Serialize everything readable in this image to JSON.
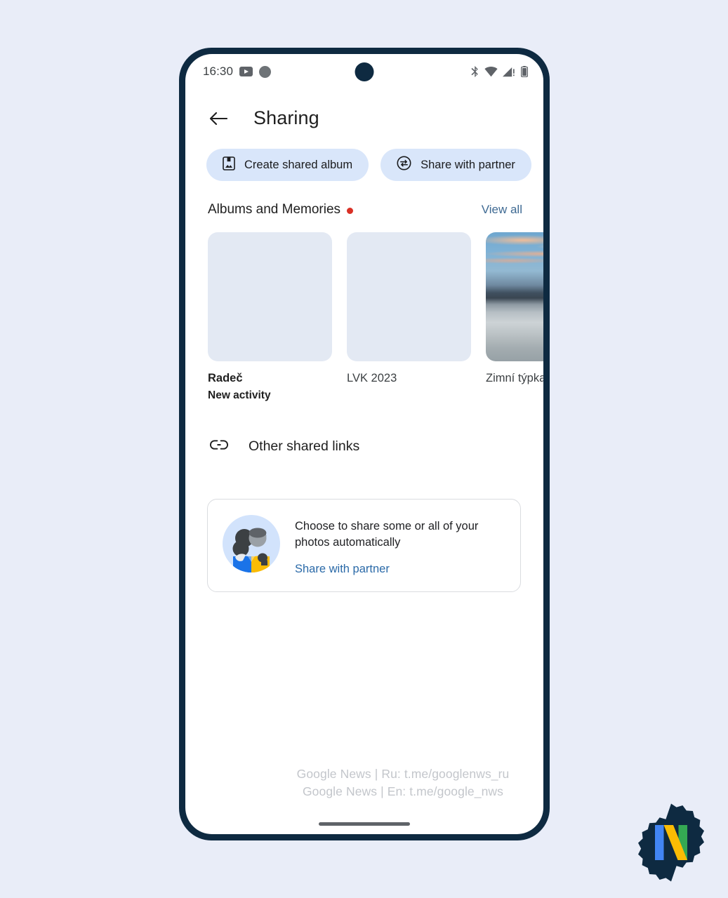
{
  "theme": {
    "page_background": "#e9edf8",
    "phone_frame": "#0e2a41",
    "chip_background": "#d9e6fa",
    "link_blue": "#3f6a93",
    "partner_link_blue": "#2b6aa8",
    "badge_red": "#d93025",
    "illustration_blue": "#1a73e8",
    "illustration_yellow": "#fbbc04"
  },
  "status_bar": {
    "time": "16:30",
    "left_icons": [
      "youtube-icon",
      "notification-dot-icon"
    ],
    "right_icons": [
      "bluetooth-icon",
      "wifi-icon",
      "cellular-signal-icon",
      "battery-icon"
    ]
  },
  "app_bar": {
    "back_icon": "arrow-left-icon",
    "title": "Sharing"
  },
  "chips": [
    {
      "icon": "album-book-icon",
      "label": "Create shared album"
    },
    {
      "icon": "swap-circle-icon",
      "label": "Share with partner"
    }
  ],
  "albums_section": {
    "title": "Albums and Memories",
    "has_badge": true,
    "view_all_label": "View all",
    "albums": [
      {
        "name": "Radeč",
        "subtitle": "New activity",
        "highlight": true,
        "thumb": "placeholder"
      },
      {
        "name": "LVK 2023",
        "subtitle": "",
        "highlight": false,
        "thumb": "placeholder"
      },
      {
        "name": "Zimní týpka",
        "subtitle": "",
        "highlight": false,
        "thumb": "winter-sunset-photo"
      }
    ]
  },
  "other_links": {
    "icon": "link-icon",
    "label": "Other shared links"
  },
  "partner_card": {
    "illustration": "two-people-illustration",
    "description": "Choose to share some or all of your photos automatically",
    "link_label": "Share with partner"
  },
  "watermark": {
    "line1": "Google News | Ru: t.me/googlenws_ru",
    "line2": "Google News | En: t.me/google_nws"
  },
  "badge_logo": {
    "letter": "N"
  }
}
